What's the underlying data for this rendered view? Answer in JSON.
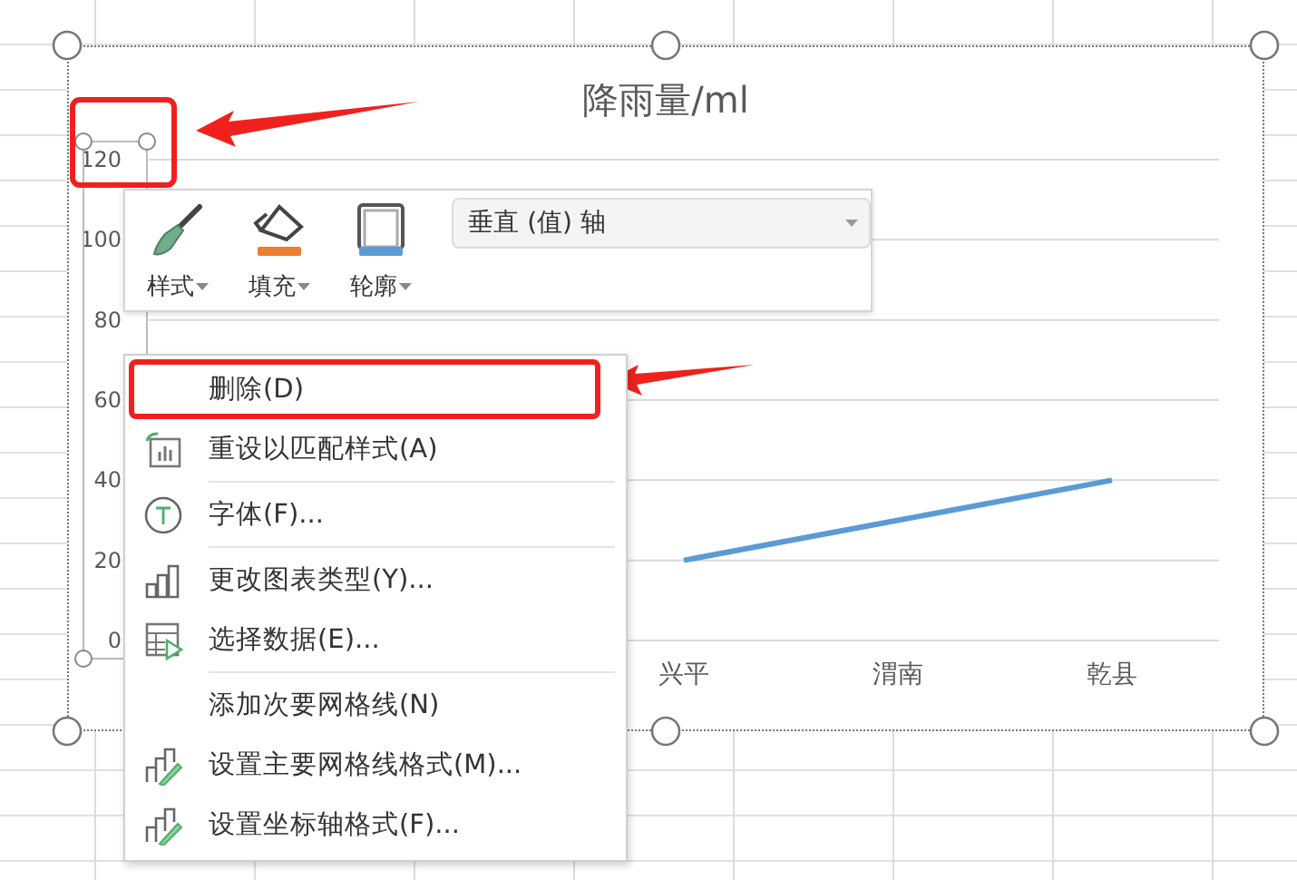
{
  "chart": {
    "axis_callout": true,
    "selected_axis": true,
    "chart_data": {
      "type": "line",
      "title": "降雨量/ml",
      "categories": [
        null,
        null,
        "兴平",
        "渭南",
        "乾县"
      ],
      "ylim": [
        0,
        120
      ],
      "yticks": [
        0,
        20,
        40,
        60,
        80,
        100,
        120
      ],
      "grid": true,
      "series": [
        {
          "color": "#5b9bd5",
          "values": [
            null,
            null,
            20,
            30,
            40
          ]
        }
      ]
    }
  },
  "mini_toolbar": {
    "buttons": [
      {
        "kind": "style",
        "label": "样式"
      },
      {
        "kind": "fill",
        "label": "填充"
      },
      {
        "kind": "outline",
        "label": "轮廓"
      }
    ],
    "element_dropdown": {
      "value": "垂直 (值) 轴"
    }
  },
  "context_menu": {
    "items": [
      {
        "kind": "command",
        "label": "删除(D)",
        "callout": true
      },
      {
        "kind": "command",
        "label": "重设以匹配样式(A)",
        "callout": false
      },
      {
        "kind": "separator"
      },
      {
        "kind": "command",
        "label": "字体(F)...",
        "callout": false
      },
      {
        "kind": "separator"
      },
      {
        "kind": "command",
        "label": "更改图表类型(Y)...",
        "callout": false
      },
      {
        "kind": "command",
        "label": "选择数据(E)...",
        "callout": false
      },
      {
        "kind": "separator"
      },
      {
        "kind": "command",
        "label": "添加次要网格线(N)",
        "callout": false
      },
      {
        "kind": "command",
        "label": "设置主要网格线格式(M)...",
        "callout": false
      },
      {
        "kind": "command",
        "label": "设置坐标轴格式(F)...",
        "callout": false
      }
    ]
  }
}
